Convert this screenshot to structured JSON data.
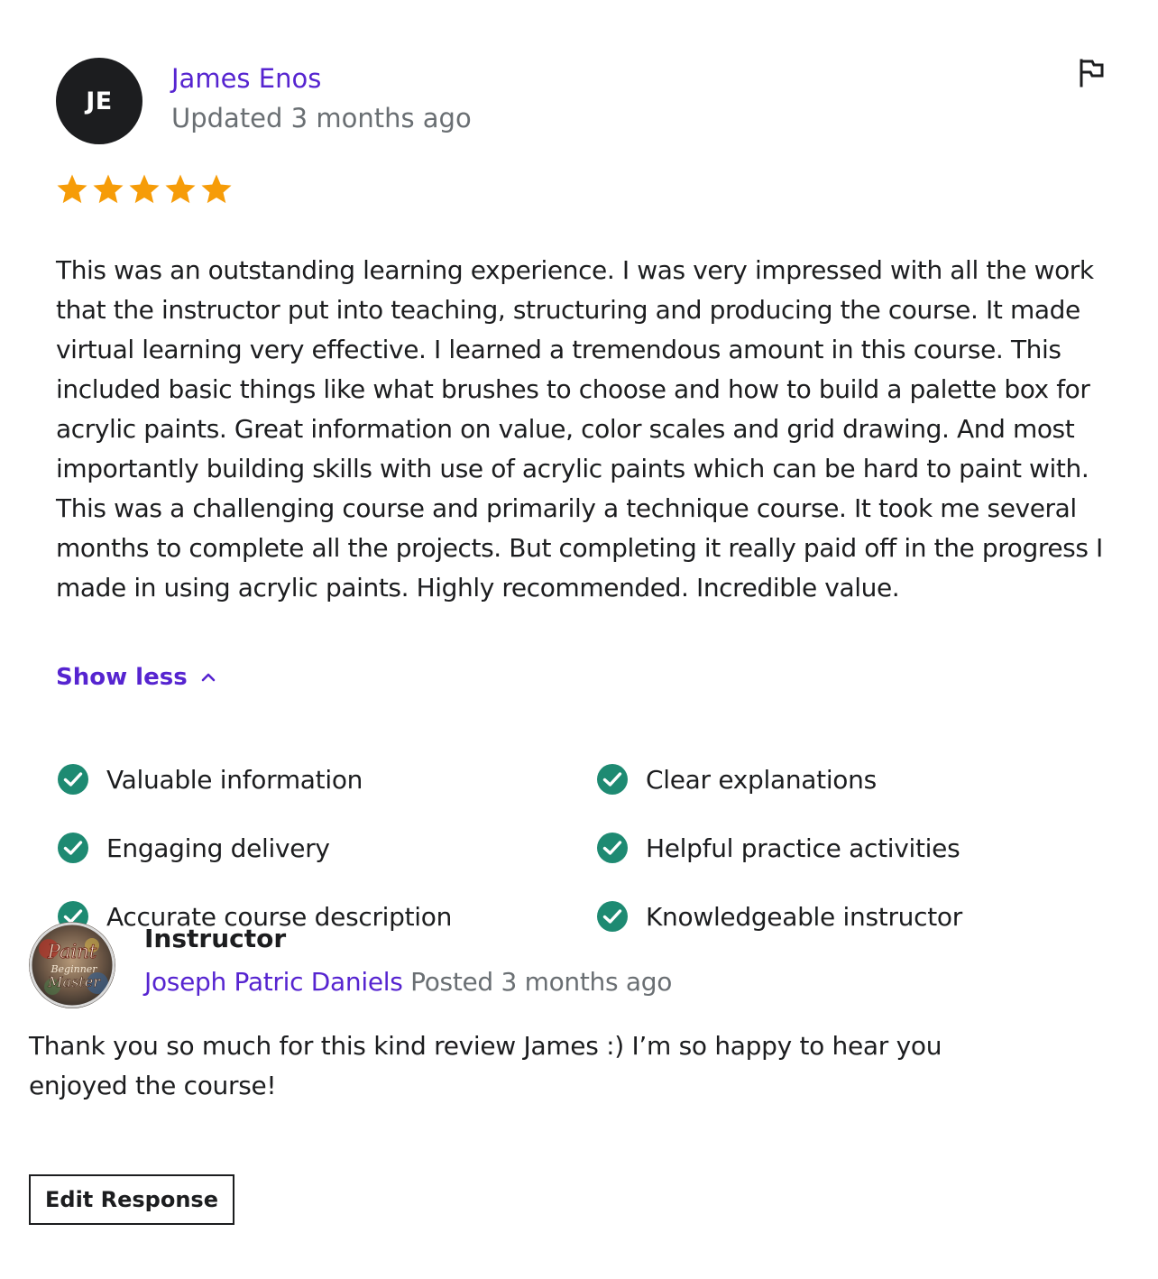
{
  "review": {
    "avatar_initials": "JE",
    "reviewer_name": "James Enos",
    "updated": "Updated 3 months ago",
    "rating": 5,
    "rating_max": 5,
    "star_color": "#f69c08",
    "body": "This was an outstanding learning experience. I was very impressed with all the work that the instructor put into teaching, structuring and producing the course. It made virtual learning very effective. I learned a tremendous amount in this course. This included basic things like what brushes to choose and how to build a palette box for acrylic paints. Great information on value, color scales and grid drawing. And most importantly building skills with use of acrylic paints which can be hard to paint with. This was a challenging course and primarily a technique course. It took me several months to complete all the projects. But completing it really paid off in the progress I made in using acrylic paints. Highly recommended. Incredible value.",
    "show_less_label": "Show less",
    "flag_icon": "flag-icon"
  },
  "tags": [
    {
      "label": "Valuable information",
      "icon": "check-circle-icon"
    },
    {
      "label": "Clear explanations",
      "icon": "check-circle-icon"
    },
    {
      "label": "Engaging delivery",
      "icon": "check-circle-icon"
    },
    {
      "label": "Helpful practice activities",
      "icon": "check-circle-icon"
    },
    {
      "label": "Accurate course description",
      "icon": "check-circle-icon"
    },
    {
      "label": "Knowledgeable instructor",
      "icon": "check-circle-icon"
    }
  ],
  "response": {
    "role": "Instructor",
    "name": "Joseph Patric Daniels",
    "posted": "Posted 3 months ago",
    "text": "Thank you so much for this kind review James :) I’m so happy to hear you enjoyed the course!",
    "edit_label": "Edit Response",
    "avatar_text": [
      "Paint",
      "Beginner",
      "Master"
    ]
  },
  "colors": {
    "link": "#5624d0",
    "muted": "#6a6f73",
    "text": "#1c1d1f",
    "check": "#1e8a72"
  }
}
